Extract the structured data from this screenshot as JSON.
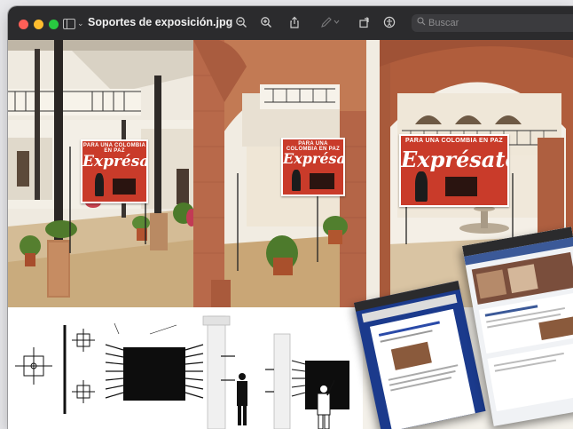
{
  "window": {
    "title": "Soportes de exposición.jpg",
    "search_placeholder": "Buscar"
  },
  "photos": {
    "poster_tagline": "PARA UNA COLOMBIA EN PAZ",
    "poster_headline": "Exprésate"
  },
  "colors": {
    "titlebar": "#2b2b2d",
    "close": "#ff5f57",
    "minimize": "#febc2e",
    "maximize": "#28c840",
    "poster_red": "#c93b2a"
  },
  "icons": [
    "zoom-out-icon",
    "zoom-in-icon",
    "share-icon",
    "markup-pen-icon",
    "rotate-icon",
    "accessibility-icon",
    "search-icon"
  ]
}
